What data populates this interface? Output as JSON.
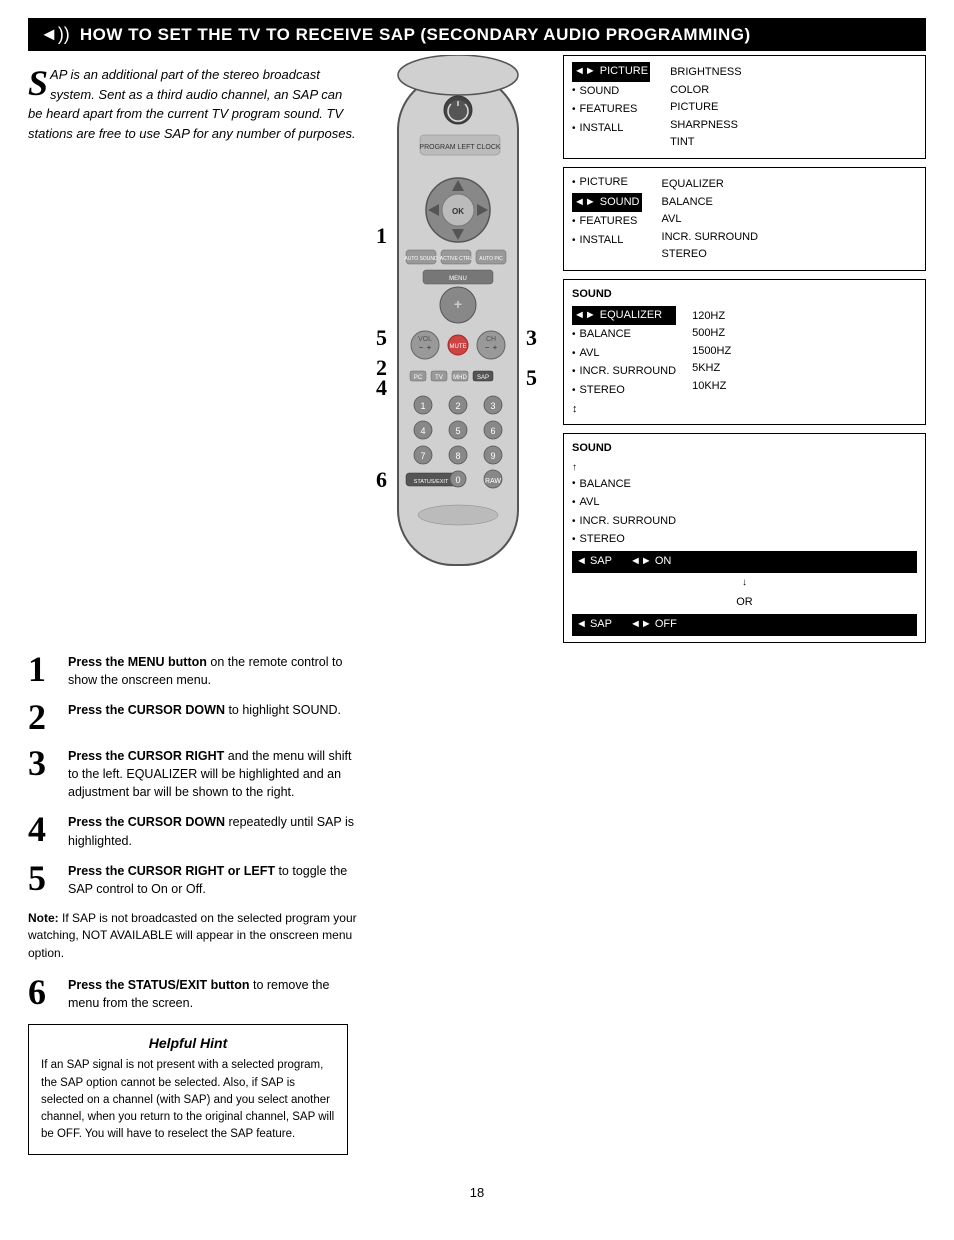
{
  "header": {
    "icon": "◄))",
    "title_prefix": "How to Set the ",
    "title_tv": "TV",
    "title_mid": " to Receive ",
    "title_sap": "SAP",
    "title_suffix": " (Secondary Audio Programming)"
  },
  "intro": {
    "drop_cap": "S",
    "text": "AP is an additional part of the stereo broadcast system.  Sent as a third audio channel, an SAP can be heard apart from the current TV program sound.  TV stations are free to use SAP for any number of purposes."
  },
  "steps": [
    {
      "num": "1",
      "text_bold": "Press the MENU button",
      "text_normal": " on the remote control to show the onscreen menu."
    },
    {
      "num": "2",
      "text_bold": "Press the CURSOR DOWN",
      "text_normal": " to highlight SOUND."
    },
    {
      "num": "3",
      "text_bold": "Press the CURSOR RIGHT",
      "text_normal": " and the menu will shift to the left. EQUALIZER will be highlighted and an adjustment bar will be shown to the right."
    },
    {
      "num": "4",
      "text_bold": "Press the CURSOR DOWN",
      "text_normal": " repeatedly until SAP is highlighted."
    },
    {
      "num": "5",
      "text_bold": "Press the CURSOR RIGHT or LEFT",
      "text_normal": " to toggle the SAP control to On or Off."
    }
  ],
  "note": {
    "label": "Note:",
    "text": " If SAP is not broadcasted on the selected program your watching, NOT AVAILABLE will appear in the onscreen menu option."
  },
  "step6": {
    "num": "6",
    "text_bold": "Press the STATUS/EXIT button",
    "text_normal": " to remove the menu from the screen."
  },
  "helpful_hint": {
    "title": "Helpful Hint",
    "text": "If an SAP signal is not present with a selected program, the SAP option cannot be selected.  Also, if SAP is selected on a channel (with SAP) and you select another channel, when you return to the original channel, SAP will be OFF.  You will have to reselect the SAP feature."
  },
  "menu1": {
    "title": "",
    "items": [
      {
        "bullet": "◄►",
        "label": "PICTURE",
        "value": "BRIGHTNESS",
        "highlighted": false,
        "arrow": true
      },
      {
        "bullet": "•",
        "label": "SOUND",
        "value": "COLOR",
        "highlighted": false
      },
      {
        "bullet": "•",
        "label": "FEATURES",
        "value": "PICTURE",
        "highlighted": false
      },
      {
        "bullet": "•",
        "label": "INSTALL",
        "value": "SHARPNESS",
        "highlighted": false
      },
      {
        "bullet": "",
        "label": "",
        "value": "TINT",
        "highlighted": false
      }
    ]
  },
  "menu2": {
    "items": [
      {
        "bullet": "•",
        "label": "PICTURE",
        "value": "EQUALIZER",
        "highlighted": false
      },
      {
        "bullet": "◄►",
        "label": "SOUND",
        "value": "BALANCE",
        "highlighted": true
      },
      {
        "bullet": "•",
        "label": "FEATURES",
        "value": "AVL",
        "highlighted": false
      },
      {
        "bullet": "•",
        "label": "INSTALL",
        "value": "INCR. SURROUND",
        "highlighted": false
      },
      {
        "bullet": "",
        "label": "",
        "value": "STEREO",
        "highlighted": false
      }
    ]
  },
  "menu3_title": "SOUND",
  "menu3": {
    "items": [
      {
        "bullet": "◄►",
        "label": "EQUALIZER",
        "value": "120HZ",
        "highlighted": true
      },
      {
        "bullet": "•",
        "label": "BALANCE",
        "value": "500HZ",
        "highlighted": false
      },
      {
        "bullet": "•",
        "label": "AVL",
        "value": "1500HZ",
        "highlighted": false
      },
      {
        "bullet": "•",
        "label": "INCR. SURROUND",
        "value": "5KHZ",
        "highlighted": false
      },
      {
        "bullet": "•",
        "label": "STEREO",
        "value": "10KHZ",
        "highlighted": false
      },
      {
        "bullet": "↕",
        "label": "",
        "value": "",
        "highlighted": false
      }
    ]
  },
  "menu4_title": "SOUND",
  "menu4": {
    "items": [
      {
        "bullet": "•",
        "label": "BALANCE",
        "value": "",
        "highlighted": false
      },
      {
        "bullet": "•",
        "label": "AVL",
        "value": "",
        "highlighted": false
      },
      {
        "bullet": "•",
        "label": "INCR. SURROUND",
        "value": "",
        "highlighted": false
      },
      {
        "bullet": "•",
        "label": "STEREO",
        "value": "",
        "highlighted": false
      }
    ],
    "sap_on": {
      "label": "◄ SAP",
      "value": "◄► ON"
    },
    "arrow_down": "↓",
    "or_text": "OR",
    "sap_off": {
      "label": "◄ SAP",
      "value": "◄► OFF"
    }
  },
  "page_number": "18"
}
